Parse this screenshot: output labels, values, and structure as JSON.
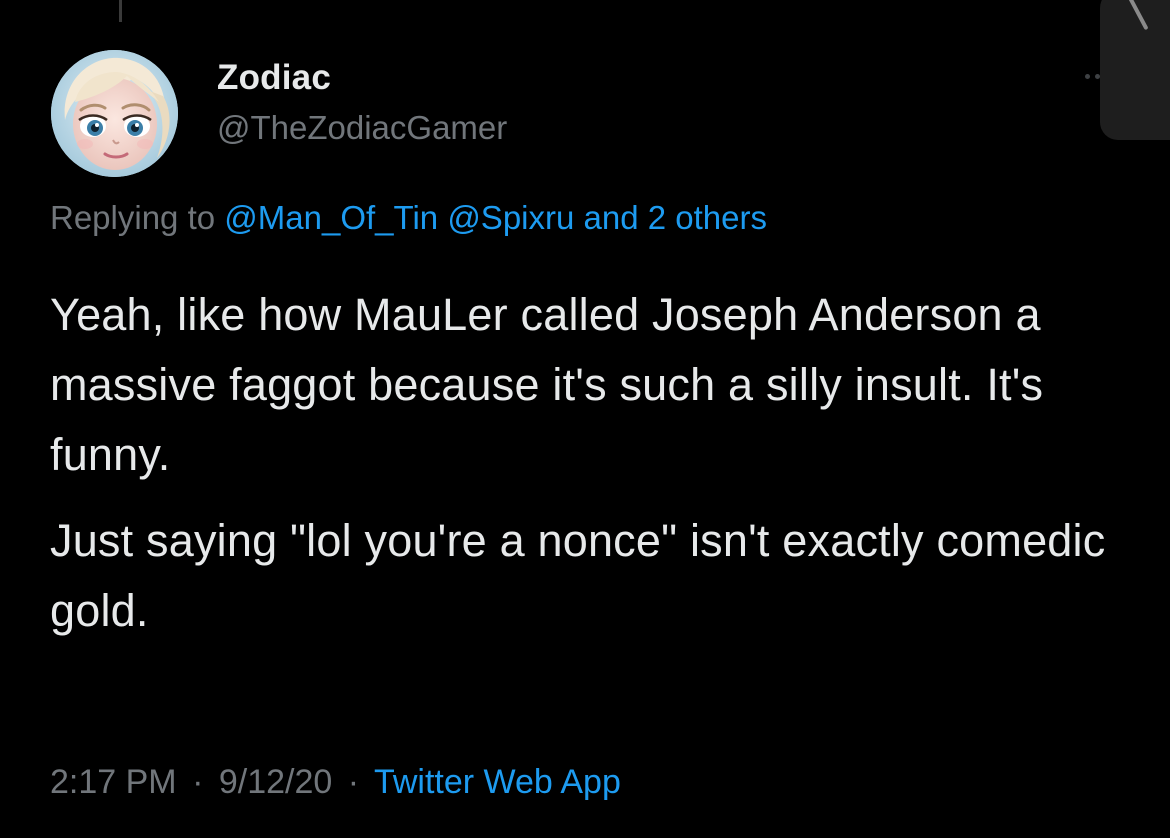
{
  "tweet": {
    "author": {
      "display_name": "Zodiac",
      "handle": "@TheZodiacGamer",
      "avatar_icon": "animated-character-avatar"
    },
    "reply_context": {
      "prefix": "Replying to",
      "mentions": [
        "@Man_Of_Tin",
        "@Spixru"
      ],
      "suffix": "and 2 others"
    },
    "paragraphs": [
      "Yeah, like how MauLer called Joseph Anderson a massive faggot because it's such a silly insult. It's funny.",
      "Just saying \"lol you're a nonce\" isn't exactly comedic gold."
    ],
    "time": "2:17 PM",
    "date": "9/12/20",
    "separator": "·",
    "source": "Twitter Web App",
    "more_icon": "more-horizontal-icon"
  },
  "colors": {
    "background": "#000000",
    "text_primary": "#E7E9EA",
    "text_secondary": "#71767B",
    "link": "#1D9BF0"
  }
}
